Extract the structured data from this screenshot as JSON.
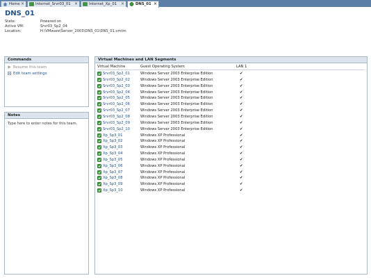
{
  "tabs": [
    {
      "label": "Home",
      "icon": "home-icon"
    },
    {
      "label": "Internet_Srvr03_01",
      "icon": "vm-icon"
    },
    {
      "label": "Internet_Xp_01",
      "icon": "vm-icon"
    },
    {
      "label": "DNS_01",
      "icon": "team-icon",
      "active": true
    }
  ],
  "header": {
    "title": "DNS_01",
    "state_label": "State:",
    "state_value": "Powered on",
    "active_vm_label": "Active VM:",
    "active_vm_value": "Srvr03_Sp2_04",
    "location_label": "Location:",
    "location_value": "H:\\VMware\\Server_2003\\DNS_01\\DNS_01.vmtm"
  },
  "commands": {
    "title": "Commands",
    "resume": "Resume this team",
    "edit": "Edit team settings"
  },
  "notes": {
    "title": "Notes",
    "placeholder": "Type here to enter notes for this team."
  },
  "vms": {
    "title": "Virtual Machines and LAN Segments",
    "col_vm": "Virtual Machine",
    "col_os": "Guest Operating System",
    "col_lan": "LAN 1",
    "check": "✔",
    "rows": [
      {
        "name": "Srvr03_Sp2_01",
        "os": "Windows Server 2003 Enterprise Edition"
      },
      {
        "name": "Srvr03_Sp2_02",
        "os": "Windows Server 2003 Enterprise Edition"
      },
      {
        "name": "Srvr03_Sp2_03",
        "os": "Windows Server 2003 Enterprise Edition"
      },
      {
        "name": "Srvr03_Sp2_04",
        "os": "Windows Server 2003 Enterprise Edition"
      },
      {
        "name": "Srvr03_Sp2_05",
        "os": "Windows Server 2003 Enterprise Edition"
      },
      {
        "name": "Srvr03_Sp2_06",
        "os": "Windows Server 2003 Enterprise Edition"
      },
      {
        "name": "Srvr03_Sp2_07",
        "os": "Windows Server 2003 Enterprise Edition"
      },
      {
        "name": "Srvr03_Sp2_08",
        "os": "Windows Server 2003 Enterprise Edition"
      },
      {
        "name": "Srvr03_Sp2_09",
        "os": "Windows Server 2003 Enterprise Edition"
      },
      {
        "name": "Srvr03_Sp2_10",
        "os": "Windows Server 2003 Enterprise Edition"
      },
      {
        "name": "Xp_Sp3_01",
        "os": "Windows XP Professional"
      },
      {
        "name": "Xp_Sp3_02",
        "os": "Windows XP Professional"
      },
      {
        "name": "Xp_Sp3_03",
        "os": "Windows XP Professional"
      },
      {
        "name": "Xp_Sp3_04",
        "os": "Windows XP Professional"
      },
      {
        "name": "Xp_Sp3_05",
        "os": "Windows XP Professional"
      },
      {
        "name": "Xp_Sp3_06",
        "os": "Windows XP Professional"
      },
      {
        "name": "Xp_Sp3_07",
        "os": "Windows XP Professional"
      },
      {
        "name": "Xp_Sp3_08",
        "os": "Windows XP Professional"
      },
      {
        "name": "Xp_Sp3_09",
        "os": "Windows XP Professional"
      },
      {
        "name": "Xp_Sp3_10",
        "os": "Windows XP Professional"
      }
    ]
  }
}
